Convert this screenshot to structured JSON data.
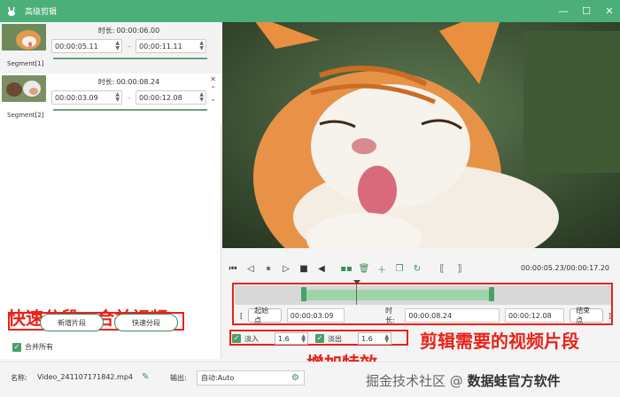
{
  "app": {
    "title": "高级剪辑",
    "icon": "rabbit-logo-icon"
  },
  "window_controls": {
    "minimize": "—",
    "maximize": "☐",
    "close": "✕"
  },
  "segments": [
    {
      "name": "Segment[1]",
      "duration_label": "时长:",
      "duration": "00:00:06.00",
      "start": "00:00:05.11",
      "end": "00:00:11.11"
    },
    {
      "name": "Segment[2]",
      "duration_label": "时长:",
      "duration": "00:00:08.24",
      "start": "00:00:03.09",
      "end": "00:00:12.08"
    }
  ],
  "left_annotation": "快速分段、合并视频",
  "buttons": {
    "add_segment": "新增片段",
    "quick_split": "快速分段"
  },
  "merge_all": {
    "label": "合并所有",
    "checked": true
  },
  "player": {
    "time": "00:00:05.23/00:00:17.20"
  },
  "range": {
    "start_label": "起始点",
    "start": "00:00:03.09",
    "duration_label": "时长:",
    "duration": "00:00:08.24",
    "end": "00:00:12.08",
    "end_label": "结束点",
    "bracket_open": "[",
    "bracket_close": "]"
  },
  "fade": {
    "in_label": "淡入",
    "in_value": "1.6",
    "out_label": "淡出",
    "out_value": "1.6"
  },
  "right_annotation": "剪辑需要的视频片段",
  "mid_annotation": "增加特效",
  "bottom": {
    "name_label": "名称:",
    "filename": "Video_241107171842.mp4",
    "output_label": "输出:",
    "output_value": "自动:Auto"
  },
  "watermark": {
    "text": "掘金技术社区 @",
    "brand": "数据蛙官方软件"
  },
  "colors": {
    "accent": "#4caf7a",
    "annotation": "#e8231a",
    "selection": "#9ed4a7"
  }
}
